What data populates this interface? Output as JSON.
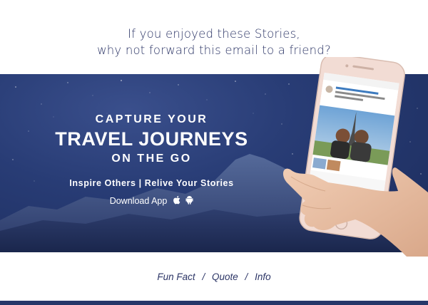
{
  "forward_note": {
    "line1": "If you enjoyed these Stories,",
    "line2": "why not forward this email to a friend?"
  },
  "banner": {
    "headline_top": "CAPTURE YOUR",
    "headline_main": "TRAVEL JOURNEYS",
    "headline_bottom": "ON THE GO",
    "tagline": "Inspire Others | Relive Your Stories",
    "download_label": "Download App",
    "icons": [
      "apple-icon",
      "android-icon"
    ],
    "phone_screen": {
      "post_text": "In the end we all went on the Eiffel Tower with Rahul and Priya",
      "caption": "Rahul Shares Priya's 2 Stories"
    }
  },
  "footer": {
    "links": [
      "Fun Fact",
      "Quote",
      "Info"
    ],
    "separator": "/"
  },
  "colors": {
    "text_navy": "#2c3566",
    "banner_blue": "#283c75",
    "bar_navy": "#263769",
    "accent_red": "#e8423d"
  }
}
